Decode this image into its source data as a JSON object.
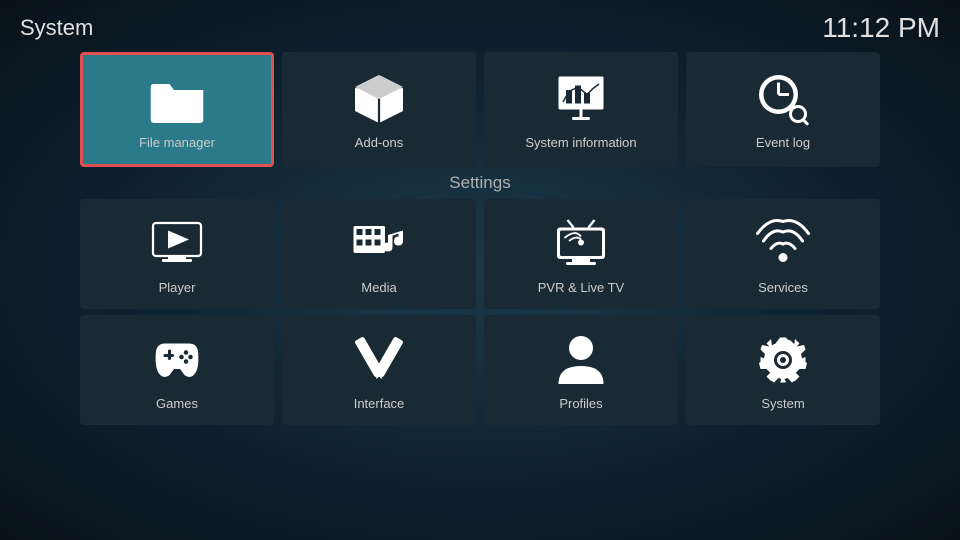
{
  "topBar": {
    "title": "System",
    "time": "11:12 PM"
  },
  "topRow": [
    {
      "id": "file-manager",
      "label": "File manager",
      "icon": "folder",
      "active": true
    },
    {
      "id": "add-ons",
      "label": "Add-ons",
      "icon": "box",
      "active": false
    },
    {
      "id": "system-information",
      "label": "System information",
      "icon": "chart",
      "active": false
    },
    {
      "id": "event-log",
      "label": "Event log",
      "icon": "clock",
      "active": false
    }
  ],
  "settingsLabel": "Settings",
  "settingsRow1": [
    {
      "id": "player",
      "label": "Player",
      "icon": "play"
    },
    {
      "id": "media",
      "label": "Media",
      "icon": "media"
    },
    {
      "id": "pvr-live-tv",
      "label": "PVR & Live TV",
      "icon": "tv"
    },
    {
      "id": "services",
      "label": "Services",
      "icon": "wifi"
    }
  ],
  "settingsRow2": [
    {
      "id": "games",
      "label": "Games",
      "icon": "gamepad"
    },
    {
      "id": "interface",
      "label": "Interface",
      "icon": "pencil"
    },
    {
      "id": "profiles",
      "label": "Profiles",
      "icon": "person"
    },
    {
      "id": "system",
      "label": "System",
      "icon": "gear"
    }
  ]
}
